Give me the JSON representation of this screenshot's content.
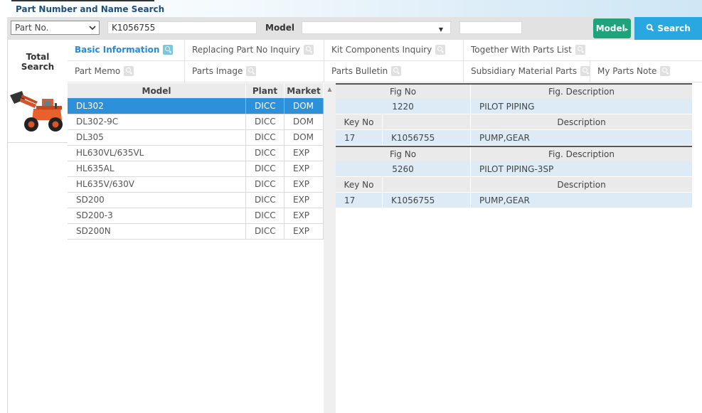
{
  "page": {
    "title": "Part Number and Name Search"
  },
  "search": {
    "type_value": "Part No.",
    "part_value": "K1056755",
    "model_label": "Model",
    "model_value": "",
    "extra_value": "",
    "model_button": "Model",
    "model_button_arrow": "▸",
    "search_button": "Search"
  },
  "side": {
    "total_line1": "Total",
    "total_line2": "Search",
    "thumbnail": "wheel-loader-photo"
  },
  "tabs_row1": [
    {
      "label": "Basic Information",
      "active": true
    },
    {
      "label": "Replacing Part No Inquiry"
    },
    {
      "label": "Kit Components Inquiry"
    },
    {
      "label": "Together With Parts List"
    }
  ],
  "tabs_row2": [
    {
      "label": "Part Memo"
    },
    {
      "label": "Parts Image"
    },
    {
      "label": "Parts Bulletin"
    },
    {
      "label": "Subsidiary Material Parts"
    },
    {
      "label": "My Parts Note"
    }
  ],
  "models": {
    "headers": [
      "Model",
      "Plant",
      "Market"
    ],
    "rows": [
      [
        "DL302",
        "DICC",
        "DOM"
      ],
      [
        "DL302-9C",
        "DICC",
        "DOM"
      ],
      [
        "DL305",
        "DICC",
        "DOM"
      ],
      [
        "HL630VL/635VL",
        "DICC",
        "EXP"
      ],
      [
        "HL635AL",
        "DICC",
        "EXP"
      ],
      [
        "HL635V/630V",
        "DICC",
        "EXP"
      ],
      [
        "SD200",
        "DICC",
        "EXP"
      ],
      [
        "SD200-3",
        "DICC",
        "EXP"
      ],
      [
        "SD200N",
        "DICC",
        "EXP"
      ]
    ]
  },
  "figures": [
    {
      "fig_no_header": "Fig No",
      "fig_desc_header": "Fig. Description",
      "fig_no": "1220",
      "fig_desc": "PILOT PIPING",
      "key_header": "Key No",
      "desc_header": "Description",
      "key_no": "17",
      "part_no": "K1056755",
      "part_desc": "PUMP,GEAR"
    },
    {
      "fig_no_header": "Fig No",
      "fig_desc_header": "Fig. Description",
      "fig_no": "5260",
      "fig_desc": "PILOT PIPING-3SP",
      "key_header": "Key No",
      "desc_header": "Description",
      "key_no": "17",
      "part_no": "K1056755",
      "part_desc": "PUMP,GEAR"
    }
  ],
  "colors": {
    "accent": "#2c91d8",
    "model_button": "#1ea37a",
    "search_button": "#29a7e1",
    "title": "#1d4f82"
  }
}
